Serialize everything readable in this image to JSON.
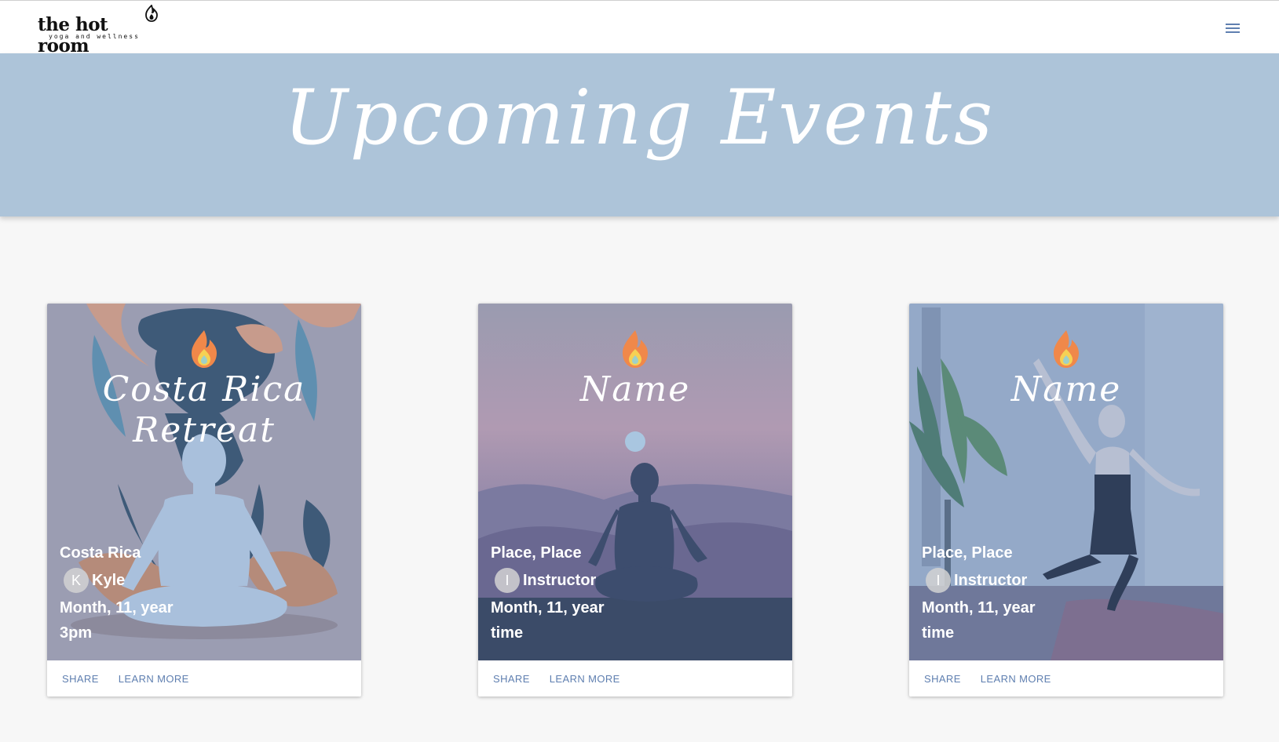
{
  "header": {
    "logo_text": "the hot room",
    "logo_tagline": "yoga and wellness",
    "menu_icon": "hamburger-menu-icon"
  },
  "hero": {
    "title": "Upcoming Events"
  },
  "colors": {
    "hero_bg": "#adc4d9",
    "accent": "#5f7fb0",
    "page_bg": "#f7f7f7"
  },
  "events": [
    {
      "title": "Costa Rica Retreat",
      "place": "Costa Rica",
      "instructor_initial": "K",
      "instructor": "Kyle",
      "date": "Month, 11, year",
      "time": "3pm",
      "share_label": "SHARE",
      "learn_more_label": "LEARN MORE"
    },
    {
      "title": "Name",
      "place": "Place, Place",
      "instructor_initial": "I",
      "instructor": "Instructor",
      "date": "Month, 11, year",
      "time": "time",
      "share_label": "SHARE",
      "learn_more_label": "LEARN MORE"
    },
    {
      "title": "Name",
      "place": "Place, Place",
      "instructor_initial": "I",
      "instructor": "Instructor",
      "date": "Month, 11, year",
      "time": "time",
      "share_label": "SHARE",
      "learn_more_label": "LEARN MORE"
    }
  ]
}
